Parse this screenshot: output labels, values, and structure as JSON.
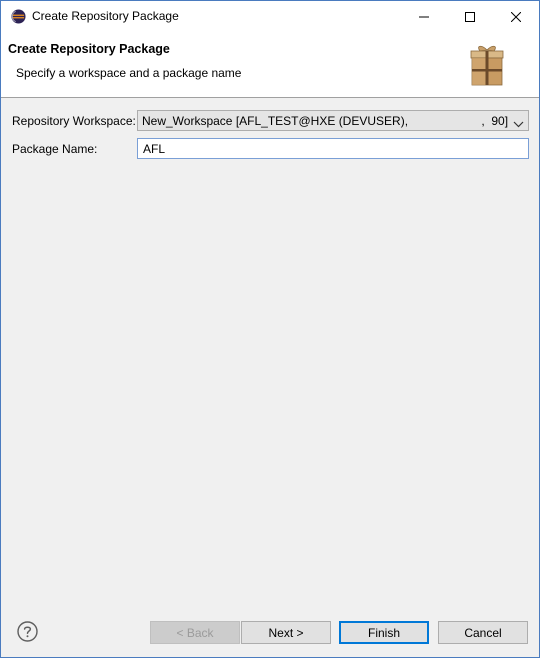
{
  "window": {
    "title": "Create Repository Package",
    "icon": "eclipse-icon",
    "controls": [
      "minimize-icon",
      "maximize-icon",
      "close-icon"
    ]
  },
  "banner": {
    "title": "Create Repository Package",
    "subtitle": "Specify a workspace and a package name",
    "icon": "package-icon"
  },
  "form": {
    "workspace_label": "Repository Workspace:",
    "workspace_value": "New_Workspace [AFL_TEST@HXE (DEVUSER),                      ,  90]",
    "package_label": "Package Name:",
    "package_value": "AFL"
  },
  "buttons": {
    "help": "help-icon",
    "back": "< Back",
    "next": "Next >",
    "finish": "Finish",
    "cancel": "Cancel"
  },
  "colors": {
    "accent": "#0078d7",
    "brand": "#2c2255"
  }
}
